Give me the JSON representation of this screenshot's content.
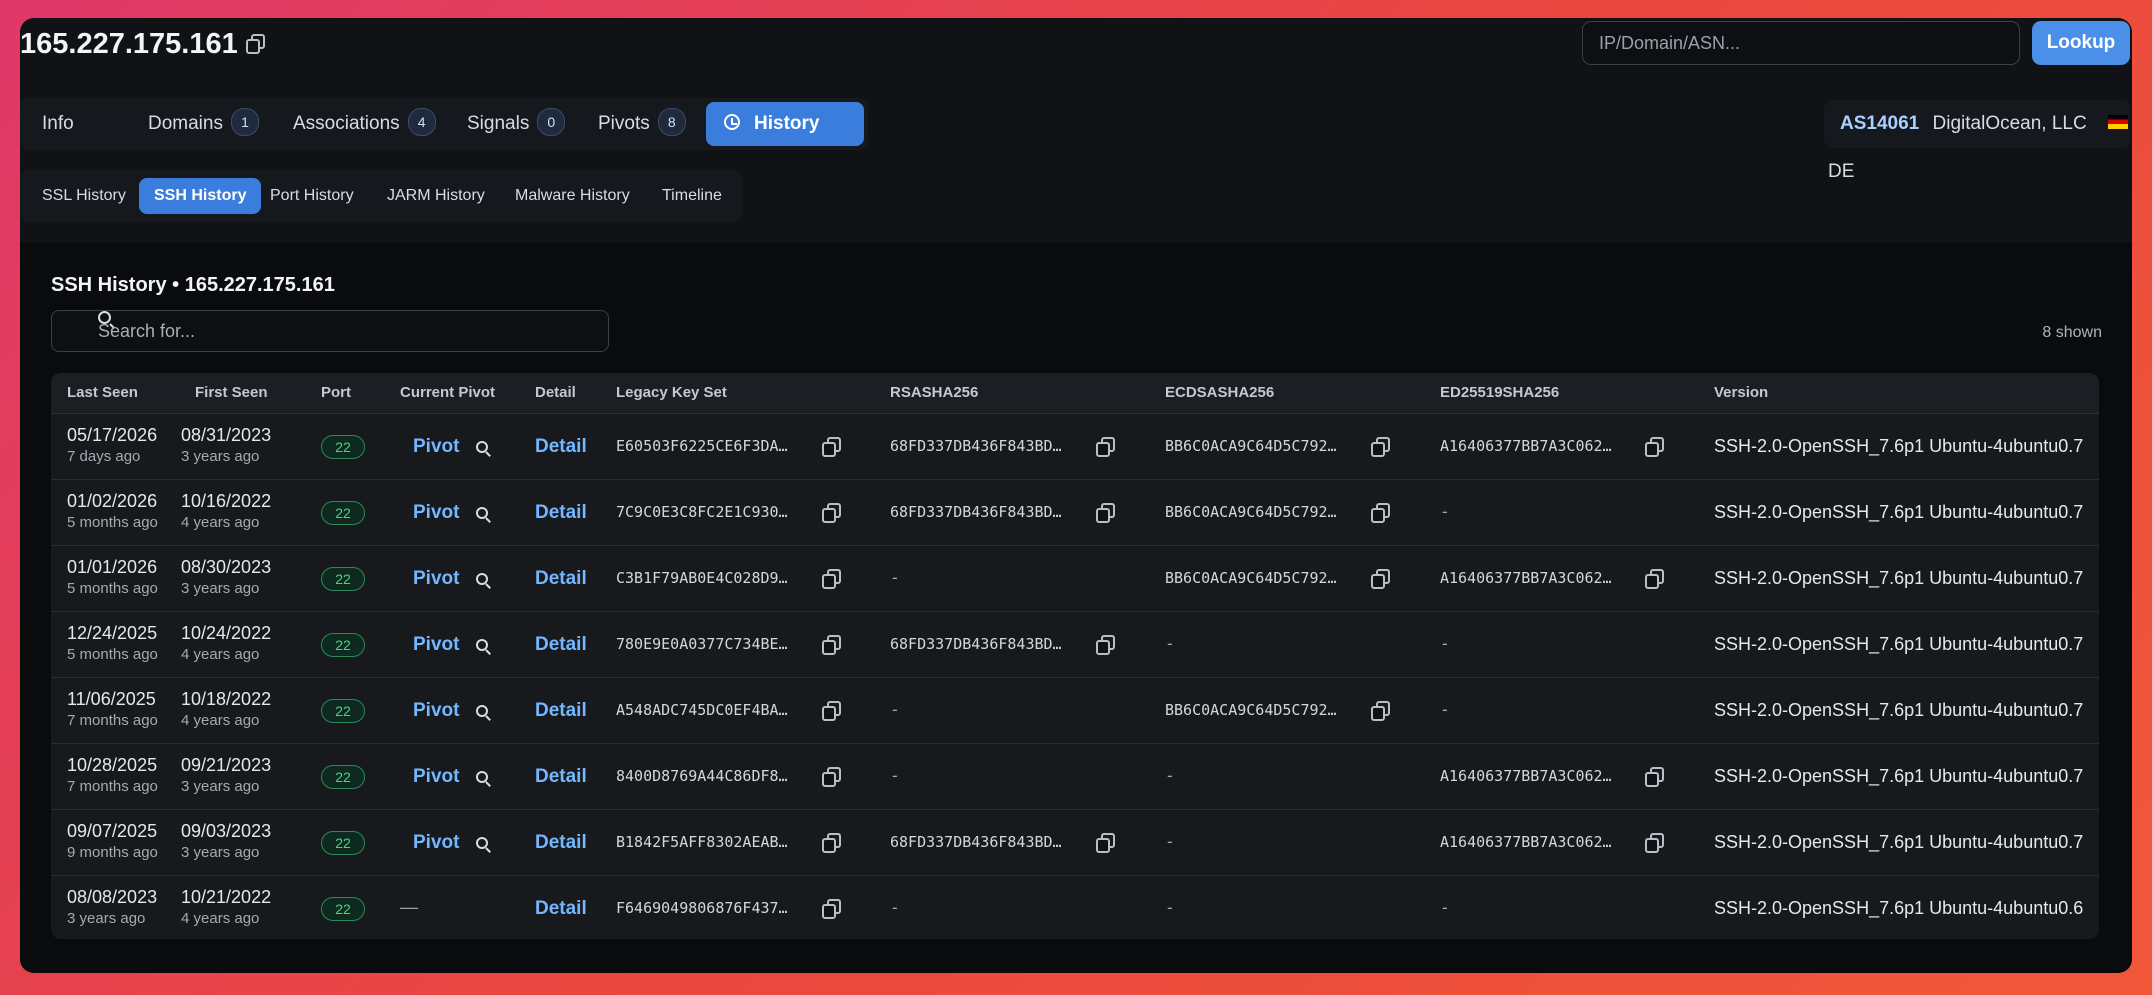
{
  "header": {
    "ip": "165.227.175.161",
    "search_placeholder": "IP/Domain/ASN...",
    "lookup_label": "Lookup"
  },
  "tabs": [
    {
      "label": "Info",
      "badge": null
    },
    {
      "label": "Domains",
      "badge": "1"
    },
    {
      "label": "Associations",
      "badge": "4"
    },
    {
      "label": "Signals",
      "badge": "0"
    },
    {
      "label": "Pivots",
      "badge": "8"
    },
    {
      "label": "History",
      "badge": null,
      "active": true,
      "icon": "history-icon"
    }
  ],
  "asn": {
    "asn": "AS14061",
    "org": "DigitalOcean, LLC",
    "country": "DE"
  },
  "subtabs": [
    "SSL History",
    "SSH History",
    "Port History",
    "JARM History",
    "Malware History",
    "Timeline"
  ],
  "active_subtab": "SSH History",
  "panel": {
    "title": "SSH History • 165.227.175.161",
    "search_placeholder": "Search for...",
    "shown": "8 shown"
  },
  "columns": [
    "Last Seen",
    "First Seen",
    "Port",
    "Current Pivot",
    "Detail",
    "Legacy Key Set",
    "RSASHA256",
    "ECDSASHA256",
    "ED25519SHA256",
    "Version"
  ],
  "labels": {
    "pivot": "Pivot",
    "detail": "Detail"
  },
  "rows": [
    {
      "last": "05/17/2026",
      "last_rel": "7 days ago",
      "first": "08/31/2023",
      "first_rel": "3 years ago",
      "port": "22",
      "pivot": true,
      "legacy": "E60503F6225CE6F3DA…",
      "rsa": "68FD337DB436F843BD…",
      "ecdsa": "BB6C0ACA9C64D5C792…",
      "ed": "A16406377BB7A3C062…",
      "version": "SSH-2.0-OpenSSH_7.6p1 Ubuntu-4ubuntu0.7"
    },
    {
      "last": "01/02/2026",
      "last_rel": "5 months ago",
      "first": "10/16/2022",
      "first_rel": "4 years ago",
      "port": "22",
      "pivot": true,
      "legacy": "7C9C0E3C8FC2E1C930…",
      "rsa": "68FD337DB436F843BD…",
      "ecdsa": "BB6C0ACA9C64D5C792…",
      "ed": "-",
      "version": "SSH-2.0-OpenSSH_7.6p1 Ubuntu-4ubuntu0.7"
    },
    {
      "last": "01/01/2026",
      "last_rel": "5 months ago",
      "first": "08/30/2023",
      "first_rel": "3 years ago",
      "port": "22",
      "pivot": true,
      "legacy": "C3B1F79AB0E4C028D9…",
      "rsa": "-",
      "ecdsa": "BB6C0ACA9C64D5C792…",
      "ed": "A16406377BB7A3C062…",
      "version": "SSH-2.0-OpenSSH_7.6p1 Ubuntu-4ubuntu0.7"
    },
    {
      "last": "12/24/2025",
      "last_rel": "5 months ago",
      "first": "10/24/2022",
      "first_rel": "4 years ago",
      "port": "22",
      "pivot": true,
      "legacy": "780E9E0A0377C734BE…",
      "rsa": "68FD337DB436F843BD…",
      "ecdsa": "-",
      "ed": "-",
      "version": "SSH-2.0-OpenSSH_7.6p1 Ubuntu-4ubuntu0.7"
    },
    {
      "last": "11/06/2025",
      "last_rel": "7 months ago",
      "first": "10/18/2022",
      "first_rel": "4 years ago",
      "port": "22",
      "pivot": true,
      "legacy": "A548ADC745DC0EF4BA…",
      "rsa": "-",
      "ecdsa": "BB6C0ACA9C64D5C792…",
      "ed": "-",
      "version": "SSH-2.0-OpenSSH_7.6p1 Ubuntu-4ubuntu0.7"
    },
    {
      "last": "10/28/2025",
      "last_rel": "7 months ago",
      "first": "09/21/2023",
      "first_rel": "3 years ago",
      "port": "22",
      "pivot": true,
      "legacy": "8400D8769A44C86DF8…",
      "rsa": "-",
      "ecdsa": "-",
      "ed": "A16406377BB7A3C062…",
      "version": "SSH-2.0-OpenSSH_7.6p1 Ubuntu-4ubuntu0.7"
    },
    {
      "last": "09/07/2025",
      "last_rel": "9 months ago",
      "first": "09/03/2023",
      "first_rel": "3 years ago",
      "port": "22",
      "pivot": true,
      "legacy": "B1842F5AFF8302AEAB…",
      "rsa": "68FD337DB436F843BD…",
      "ecdsa": "-",
      "ed": "A16406377BB7A3C062…",
      "version": "SSH-2.0-OpenSSH_7.6p1 Ubuntu-4ubuntu0.7"
    },
    {
      "last": "08/08/2023",
      "last_rel": "3 years ago",
      "first": "10/21/2022",
      "first_rel": "4 years ago",
      "port": "22",
      "pivot": false,
      "pivot_text": "—",
      "legacy": "F6469049806876F437…",
      "rsa": "-",
      "ecdsa": "-",
      "ed": "-",
      "version": "SSH-2.0-OpenSSH_7.6p1 Ubuntu-4ubuntu0.6"
    }
  ]
}
